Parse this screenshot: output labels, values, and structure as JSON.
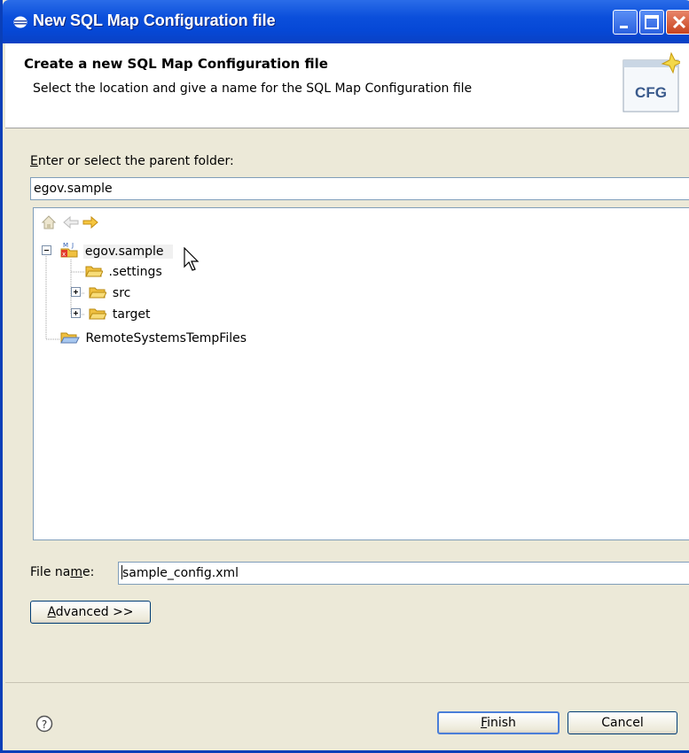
{
  "window": {
    "title": "New SQL Map Configuration file"
  },
  "header": {
    "title": "Create a new SQL Map Configuration file",
    "description": "Select the location and give a name for the SQL Map Configuration file",
    "icon_label": "CFG"
  },
  "parent_folder": {
    "label_first_char": "E",
    "label_rest": "nter or select the parent folder:",
    "value": "egov.sample"
  },
  "tree": {
    "items": [
      {
        "label": "egov.sample",
        "expanded": true,
        "selected": true,
        "level": 0
      },
      {
        "label": ".settings",
        "level": 1
      },
      {
        "label": "src",
        "expanded": false,
        "level": 1
      },
      {
        "label": "target",
        "expanded": false,
        "level": 1
      },
      {
        "label": "RemoteSystemsTempFiles",
        "level": 0
      }
    ]
  },
  "file_name": {
    "label_before": "File na",
    "label_mnemonic": "m",
    "label_after": "e:",
    "value": "sample_config.xml"
  },
  "buttons": {
    "advanced_mnemonic": "A",
    "advanced_rest": "dvanced >>",
    "finish_mnemonic": "F",
    "finish_rest": "inish",
    "cancel": "Cancel"
  },
  "colors": {
    "titlebar": "#0b4fdb",
    "dialog_bg": "#ece9d8",
    "folder": "#f0c040"
  }
}
